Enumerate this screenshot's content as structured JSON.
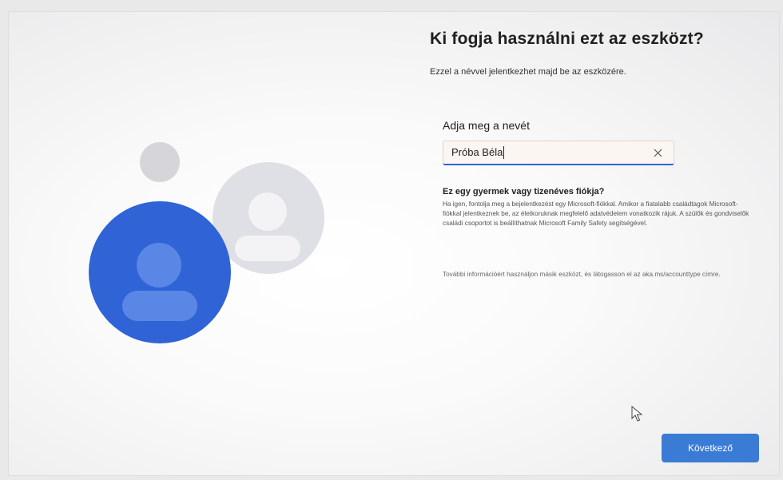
{
  "page": {
    "title": "Ki fogja használni ezt az eszközt?",
    "subtitle": "Ezzel a névvel jelentkezhet majd be az eszközére."
  },
  "name_field": {
    "label": "Adja meg a nevét",
    "value": "Próba Béla",
    "clear_icon": "close-icon"
  },
  "child_account": {
    "heading": "Ez egy gyermek vagy tizenéves fiókja?",
    "text": "Ha igen, fontolja meg a bejelentkezést egy Microsoft-fiókkal. Amikor a fiatalabb családtagok Microsoft-fiókkal jelentkeznek be, az életkoruknak megfelelő adatvédelem vonatkozik rájuk. A szülők és gondviselők családi csoportot is beállíthatnak Microsoft Family Safety segítségével."
  },
  "more_info": "További információért használjon másik eszközt, és látogasson el az aka.ms/accounttype címre.",
  "buttons": {
    "next": "Következő"
  },
  "colors": {
    "accent": "#2f63d6",
    "button": "#3a7bd5"
  },
  "icons": {
    "illustration": "user-avatar-icon",
    "cursor": "mouse-pointer-icon"
  }
}
